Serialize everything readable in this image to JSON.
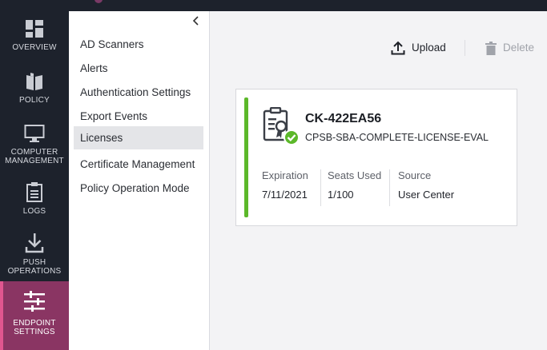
{
  "nav": {
    "items": [
      {
        "label": "OVERVIEW",
        "icon": "dashboard-grid-icon"
      },
      {
        "label": "POLICY",
        "icon": "policy-book-icon"
      },
      {
        "label": "COMPUTER MANAGEMENT",
        "icon": "monitor-icon"
      },
      {
        "label": "LOGS",
        "icon": "clipboard-icon"
      },
      {
        "label": "PUSH OPERATIONS",
        "icon": "download-icon"
      },
      {
        "label": "ENDPOINT SETTINGS",
        "icon": "sliders-icon"
      }
    ],
    "active": "ENDPOINT SETTINGS",
    "accent_color": "#8a3563"
  },
  "submenu": {
    "collapse_icon": "chevron-left-icon",
    "items": [
      "AD Scanners",
      "Alerts",
      "Authentication Settings",
      "Export Events",
      "Licenses",
      "Certificate Management",
      "Policy Operation Mode"
    ],
    "active": "Licenses"
  },
  "toolbar": {
    "upload_label": "Upload",
    "delete_label": "Delete"
  },
  "license": {
    "id": "CK-422EA56",
    "name": "CPSB-SBA-COMPLETE-LICENSE-EVAL",
    "status_color": "#5cb82a",
    "columns": [
      {
        "header": "Expiration",
        "value": "7/11/2021"
      },
      {
        "header": "Seats Used",
        "value": "1/100"
      },
      {
        "header": "Source",
        "value": "User Center"
      }
    ]
  }
}
